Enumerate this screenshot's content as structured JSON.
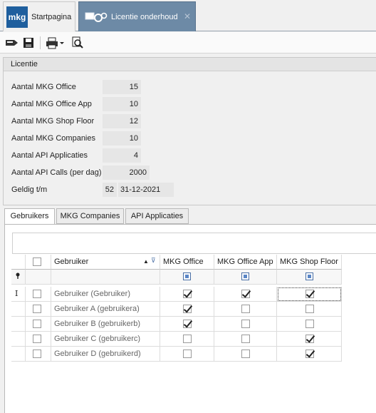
{
  "tabs": {
    "home_logo": "mkg",
    "home_label": "Startpagina",
    "active_label": "Licentie onderhoud",
    "close_glyph": "✕"
  },
  "toolbar": {
    "icons": [
      "exit-icon",
      "save-icon",
      "print-icon",
      "dropdown-arrow-icon",
      "print-preview-icon"
    ]
  },
  "licentie": {
    "title": "Licentie",
    "fields": [
      {
        "label": "Aantal MKG Office",
        "value": "15"
      },
      {
        "label": "Aantal MKG Office App",
        "value": "10"
      },
      {
        "label": "Aantal MKG Shop Floor",
        "value": "12"
      },
      {
        "label": "Aantal MKG Companies",
        "value": "10"
      },
      {
        "label": "Aantal API Applicaties",
        "value": "4"
      },
      {
        "label": "Aantal API Calls (per dag)",
        "value": "2000"
      }
    ],
    "geldig": {
      "label": "Geldig t/m",
      "week": "52",
      "date": "31-12-2021"
    }
  },
  "subtabs": [
    "Gebruikers",
    "MKG Companies",
    "API Applicaties"
  ],
  "grid": {
    "columns": [
      "Gebruiker",
      "MKG Office",
      "MKG Office App",
      "MKG Shop Floor"
    ],
    "sort_glyph": "▲",
    "filter_glyph": "⊽",
    "rows": [
      {
        "name": "Gebruiker (Gebruiker)",
        "office": true,
        "app": true,
        "shop": true
      },
      {
        "name": "Gebruiker A (gebruikera)",
        "office": true,
        "app": false,
        "shop": false
      },
      {
        "name": "Gebruiker B (gebruikerb)",
        "office": true,
        "app": false,
        "shop": false
      },
      {
        "name": "Gebruiker C (gebruikerc)",
        "office": false,
        "app": false,
        "shop": true
      },
      {
        "name": "Gebruiker D (gebruikerd)",
        "office": false,
        "app": false,
        "shop": true
      }
    ]
  },
  "colors": {
    "active_tab": "#6d8aa6",
    "logo": "#1f5f9e",
    "filter_check": "#5a86c6"
  }
}
